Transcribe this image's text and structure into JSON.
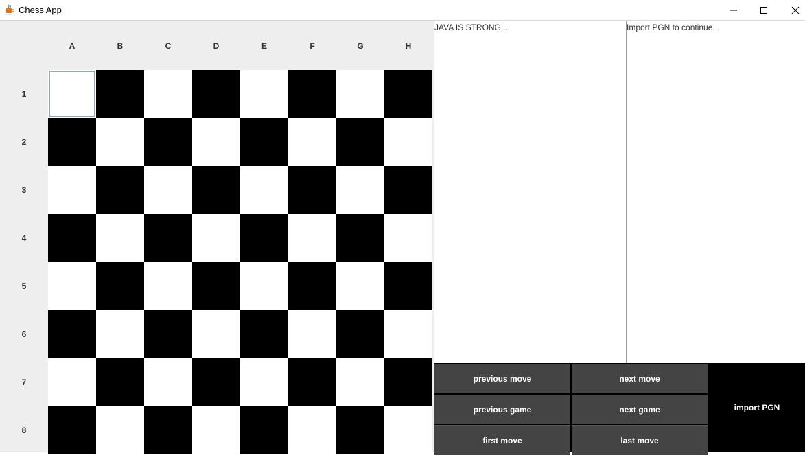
{
  "window": {
    "title": "Chess App"
  },
  "board": {
    "columns": [
      "A",
      "B",
      "C",
      "D",
      "E",
      "F",
      "G",
      "H"
    ],
    "rows": [
      "1",
      "2",
      "3",
      "4",
      "5",
      "6",
      "7",
      "8"
    ],
    "selected_square": "A1"
  },
  "panes": {
    "left_text": "JAVA IS STRONG...",
    "right_text": "Import PGN to continue..."
  },
  "controls": {
    "previous_move": "previous move",
    "next_move": "next move",
    "previous_game": "previous game",
    "next_game": "next game",
    "first_move": "first move",
    "last_move": "last move",
    "import_pgn": "import PGN"
  },
  "colors": {
    "light_square": "#ffffff",
    "dark_square": "#000000",
    "button_bg": "#444444",
    "board_bg": "#eeeeee"
  }
}
